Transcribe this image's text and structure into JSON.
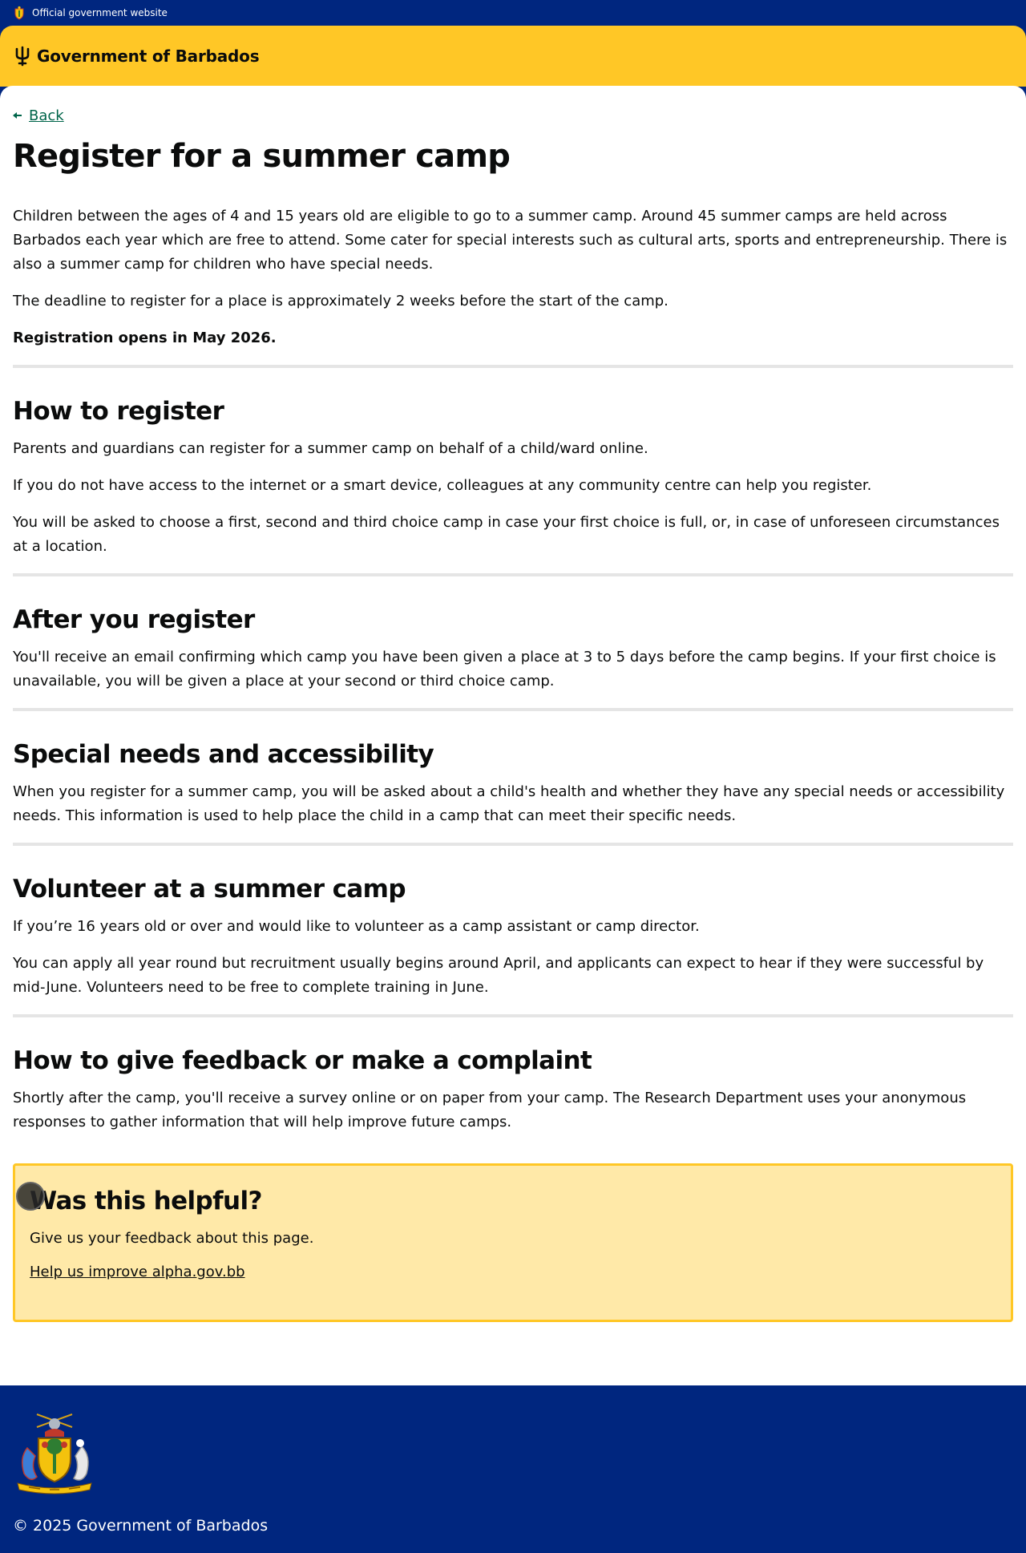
{
  "topbar": {
    "label": "Official government website"
  },
  "header": {
    "brand": "Government of Barbados"
  },
  "nav": {
    "back": "Back"
  },
  "page": {
    "title": "Register for a summer camp",
    "intro": [
      "Children between the ages of 4 and 15 years old are eligible to go to a summer camp. Around 45 summer camps are held across Barbados each year which are free to attend. Some cater for special interests such as cultural arts, sports and entrepreneurship. There is also a summer camp for children who have special needs.",
      "The deadline to register for a place is approximately 2 weeks before the start of the camp."
    ],
    "notice": "Registration opens in May 2026."
  },
  "sections": [
    {
      "heading": "How to register",
      "paragraphs": [
        "Parents and guardians can register for a summer camp on behalf of a child/ward online.",
        "If you do not have access to the internet or a smart device, colleagues at any community centre can help you register.",
        "You will be asked to choose a first, second and third choice camp in case your first choice is full, or, in case of unforeseen circumstances at a location."
      ]
    },
    {
      "heading": "After you register",
      "paragraphs": [
        "You'll receive an email confirming which camp you have been given a place at 3 to 5 days before the camp begins. If your first choice is unavailable, you will be given a place at your second or third choice camp."
      ]
    },
    {
      "heading": "Special needs and accessibility",
      "paragraphs": [
        "When you register for a summer camp, you will be asked about a child's health and whether they have any special needs or accessibility needs. This information is used to help place the child in a camp that can meet their specific needs."
      ]
    },
    {
      "heading": "Volunteer at a summer camp",
      "paragraphs": [
        "If you’re 16 years old or over and would like to volunteer as a camp assistant or camp director.",
        "You can apply all year round but recruitment usually begins around April, and applicants can expect to hear if they were successful by mid-June. Volunteers need to be free to complete training in June."
      ]
    },
    {
      "heading": "How to give feedback or make a complaint",
      "paragraphs": [
        "Shortly after the camp, you'll receive a survey online or on paper from your camp. The Research Department uses your anonymous responses to gather information that will help improve future camps."
      ]
    }
  ],
  "feedback": {
    "heading": "Was this helpful?",
    "text": "Give us your feedback about this page.",
    "link": "Help us improve alpha.gov.bb"
  },
  "footer": {
    "copyright": "© 2025 Government of Barbados"
  },
  "colors": {
    "navy": "#00267f",
    "gold": "#ffc726",
    "link_green": "#00654a",
    "feedback_bg": "#ffe9a8"
  },
  "icons": {
    "topbar": "coat-of-arms-icon",
    "header": "trident-icon",
    "back": "arrow-left-icon",
    "footer": "coat-of-arms-icon"
  }
}
